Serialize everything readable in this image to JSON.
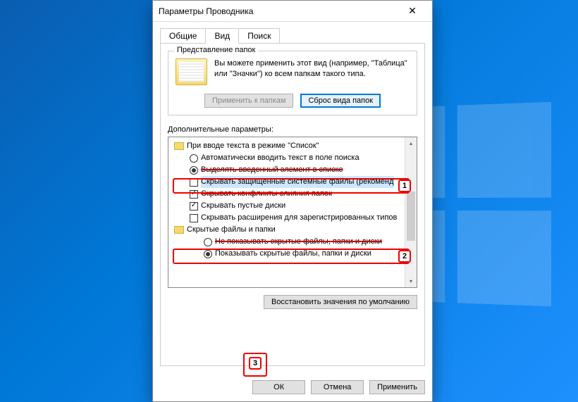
{
  "dialog": {
    "title": "Параметры Проводника",
    "tabs": {
      "general": "Общие",
      "view": "Вид",
      "search": "Поиск"
    }
  },
  "group": {
    "legend": "Представление папок",
    "text": "Вы можете применить этот вид (например, \"Таблица\" или \"Значки\") ко всем папкам такого типа.",
    "apply": "Применить к папкам",
    "reset": "Сброс вида папок"
  },
  "adv": {
    "label": "Дополнительные параметры:",
    "items": {
      "inputMode": "При вводе текста в режиме \"Список\"",
      "autoType": "Автоматически вводить текст в поле поиска",
      "highlightTyped": "Выделять введенный элемент в списке",
      "hideProtected": "Скрывать защищенные системные файлы (рекоменд",
      "hideMerge": "Скрывать конфликты слияния папок",
      "hideEmpty": "Скрывать пустые диски",
      "hideExt": "Скрывать расширения для зарегистрированных типов",
      "hiddenFolder": "Скрытые файлы и папки",
      "dontShow": "Не показывать скрытые файлы, папки и диски",
      "showHidden": "Показывать скрытые файлы, папки и диски"
    }
  },
  "restore": "Восстановить значения по умолчанию",
  "footer": {
    "ok": "ОК",
    "cancel": "Отмена",
    "apply": "Применить"
  },
  "ann": {
    "n1": "1",
    "n2": "2",
    "n3": "3"
  }
}
